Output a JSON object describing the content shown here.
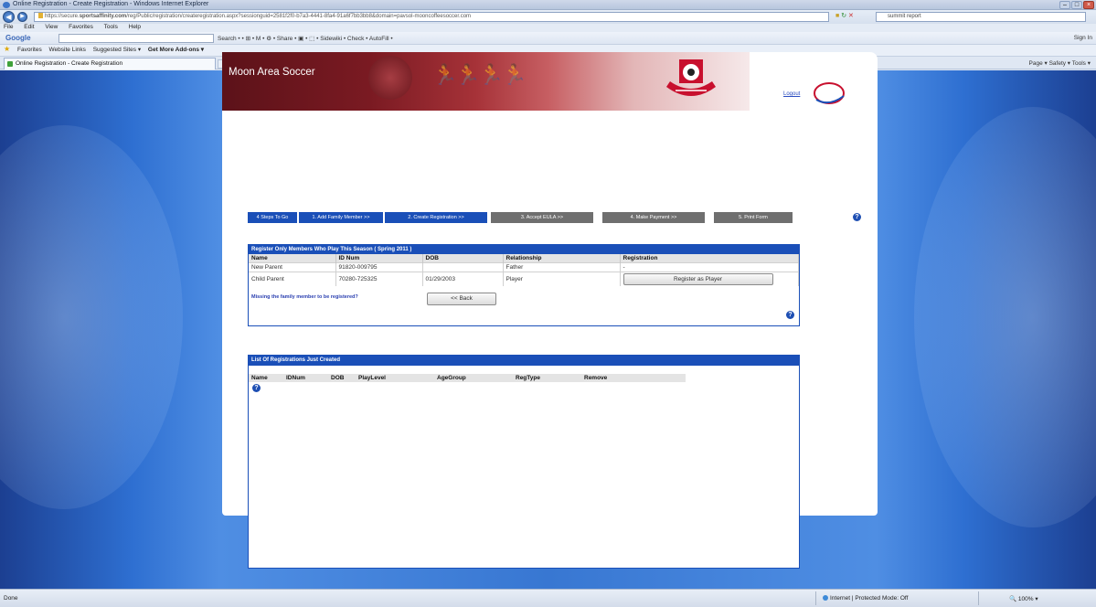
{
  "browser": {
    "window_title": "Online Registration - Create Registration - Windows Internet Explorer",
    "url_prefix": "https://secure.",
    "url_domain": "sportsaffinity.com",
    "url_rest": "/reg/Public/registration/createregistration.aspx?sessionguid=2581f2f0-b7a3-4441-8fa4-91a6f7bb3bb8&domain=pavsol-mooncoffeesoccer.com",
    "search_text": "summit report",
    "menu": [
      "File",
      "Edit",
      "View",
      "Favorites",
      "Tools",
      "Help"
    ],
    "google_label": "Google",
    "google_tools": "Search • • ⊞ • M • ⚙ • Share • ▣ • ⬚ • Sidewiki • Check • AutoFill •",
    "google_right": "Sign In",
    "favorites_label": "Favorites",
    "fav_items": [
      "Website Links",
      "Suggested Sites ▾",
      "Get More Add-ons ▾"
    ],
    "tab_title": "Online Registration - Create Registration",
    "command_bar": "Page ▾  Safety ▾  Tools ▾",
    "status_done": "Done",
    "status_zone": "Internet | Protected Mode: Off",
    "status_zoom": "100%"
  },
  "site": {
    "title": "Moon Area Soccer",
    "login_label": "Logout"
  },
  "steps": [
    {
      "label": "4 Steps To Go",
      "state": "active"
    },
    {
      "label": "1. Add Family Member >>",
      "state": "done"
    },
    {
      "label": "2. Create Registration >>",
      "state": "done"
    },
    {
      "label": "3. Accept EULA >>",
      "state": "todo"
    },
    {
      "label": "4. Make Payment >>",
      "state": "todo"
    },
    {
      "label": "5. Print Form",
      "state": "todo"
    }
  ],
  "members_panel": {
    "title": "Register Only Members Who Play This Season ( Spring 2011 )",
    "columns": [
      "Name",
      "ID Num",
      "DOB",
      "Relationship",
      "Registration"
    ],
    "rows": [
      {
        "name": "New Parent",
        "id": "91820-009795",
        "dob": "",
        "relationship": "Father",
        "registration": "-"
      },
      {
        "name": "Child Parent",
        "id": "70280-725325",
        "dob": "01/29/2003",
        "relationship": "Player",
        "registration_button": "Register as Player"
      }
    ],
    "missing_text": "Missing the family member to be registered?",
    "back_button": "<< Back"
  },
  "registrations_panel": {
    "title": "List Of Registrations Just Created",
    "columns": [
      "Name",
      "IDNum",
      "DOB",
      "PlayLevel",
      "AgeGroup",
      "RegType",
      "Remove"
    ]
  }
}
